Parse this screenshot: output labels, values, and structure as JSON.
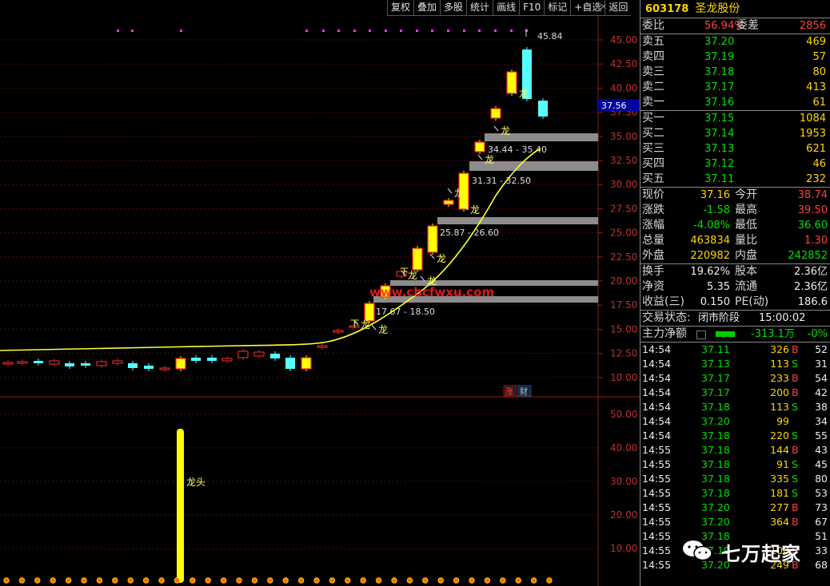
{
  "toolbar": [
    "复权",
    "叠加",
    "多股",
    "统计",
    "画线",
    "F10",
    "标记",
    "+自选",
    "返回"
  ],
  "chart": {
    "price_axis": [
      "45.00",
      "42.50",
      "40.00",
      "37.50",
      "35.00",
      "32.50",
      "30.00",
      "27.50",
      "25.00",
      "22.50",
      "20.00",
      "17.50",
      "15.00",
      "12.50",
      "10.00"
    ],
    "current_price_tag": "37.56",
    "high_label": "45.84",
    "zones": [
      "34.44 - 35.40",
      "31.31 - 32.50",
      "25.87 - 26.60",
      "17.67 - 18.50"
    ],
    "dragon": "龙",
    "xia": "下",
    "zhang": "涨",
    "cai": "财",
    "watermark_site": "www.cbcfwxu.com"
  },
  "sub_chart": {
    "axis": [
      "50.00",
      "40.00",
      "30.00",
      "20.00",
      "10.00"
    ],
    "longtou_label": "龙头"
  },
  "panel": {
    "code": "603178",
    "name": "圣龙股份",
    "weibi": {
      "label": "委比",
      "value": "56.94%",
      "label2": "委差",
      "value2": "2856"
    },
    "asks": [
      {
        "label": "卖五",
        "price": "37.20",
        "vol": "469"
      },
      {
        "label": "卖四",
        "price": "37.19",
        "vol": "57"
      },
      {
        "label": "卖三",
        "price": "37.18",
        "vol": "80"
      },
      {
        "label": "卖二",
        "price": "37.17",
        "vol": "413"
      },
      {
        "label": "卖一",
        "price": "37.16",
        "vol": "61"
      }
    ],
    "bids": [
      {
        "label": "买一",
        "price": "37.15",
        "vol": "1084"
      },
      {
        "label": "买二",
        "price": "37.14",
        "vol": "1953"
      },
      {
        "label": "买三",
        "price": "37.13",
        "vol": "621"
      },
      {
        "label": "买四",
        "price": "37.12",
        "vol": "46"
      },
      {
        "label": "买五",
        "price": "37.11",
        "vol": "232"
      }
    ],
    "stats": [
      {
        "l1": "现价",
        "v1": "37.16",
        "l2": "今开",
        "v2": "38.74"
      },
      {
        "l1": "涨跌",
        "v1": "-1.58",
        "l2": "最高",
        "v2": "39.50"
      },
      {
        "l1": "涨幅",
        "v1": "-4.08%",
        "l2": "最低",
        "v2": "36.60"
      },
      {
        "l1": "总量",
        "v1": "463834",
        "l2": "量比",
        "v2": "1.30"
      },
      {
        "l1": "外盘",
        "v1": "220982",
        "l2": "内盘",
        "v2": "242852"
      }
    ],
    "stats2": [
      {
        "l1": "换手",
        "v1": "19.62%",
        "l2": "股本",
        "v2": "2.36亿"
      },
      {
        "l1": "净资",
        "v1": "5.35",
        "l2": "流通",
        "v2": "2.36亿"
      },
      {
        "l1": "收益(三)",
        "v1": "0.150",
        "l2": "PE(动)",
        "v2": "186.6"
      }
    ],
    "status": {
      "label": "交易状态:",
      "state": "闭市阶段",
      "time": "15:00:02"
    },
    "netflow": {
      "label": "主力净额",
      "value": "-313.1万",
      "pct": "-0%"
    },
    "ticks": [
      {
        "t": "14:54",
        "p": "37.11",
        "v": "326",
        "d": "B",
        "n": "52"
      },
      {
        "t": "14:54",
        "p": "37.13",
        "v": "113",
        "d": "S",
        "n": "31"
      },
      {
        "t": "14:54",
        "p": "37.17",
        "v": "233",
        "d": "B",
        "n": "54"
      },
      {
        "t": "14:54",
        "p": "37.17",
        "v": "200",
        "d": "B",
        "n": "42"
      },
      {
        "t": "14:54",
        "p": "37.18",
        "v": "113",
        "d": "S",
        "n": "38"
      },
      {
        "t": "14:54",
        "p": "37.20",
        "v": "99",
        "d": "",
        "n": "34"
      },
      {
        "t": "14:54",
        "p": "37.18",
        "v": "220",
        "d": "S",
        "n": "55"
      },
      {
        "t": "14:55",
        "p": "37.18",
        "v": "144",
        "d": "B",
        "n": "43"
      },
      {
        "t": "14:55",
        "p": "37.18",
        "v": "91",
        "d": "S",
        "n": "45"
      },
      {
        "t": "14:55",
        "p": "37.18",
        "v": "335",
        "d": "S",
        "n": "80"
      },
      {
        "t": "14:55",
        "p": "37.18",
        "v": "181",
        "d": "S",
        "n": "53"
      },
      {
        "t": "14:55",
        "p": "37.20",
        "v": "277",
        "d": "B",
        "n": "73"
      },
      {
        "t": "14:55",
        "p": "37.20",
        "v": "364",
        "d": "B",
        "n": "67"
      },
      {
        "t": "14:55",
        "p": "37.18",
        "v": "",
        "d": "",
        "n": "51"
      },
      {
        "t": "14:55",
        "p": "37.19",
        "v": "100",
        "d": "B",
        "n": "33"
      },
      {
        "t": "14:55",
        "p": "37.20",
        "v": "249",
        "d": "B",
        "n": "68"
      }
    ],
    "watermark": "七万起家"
  }
}
